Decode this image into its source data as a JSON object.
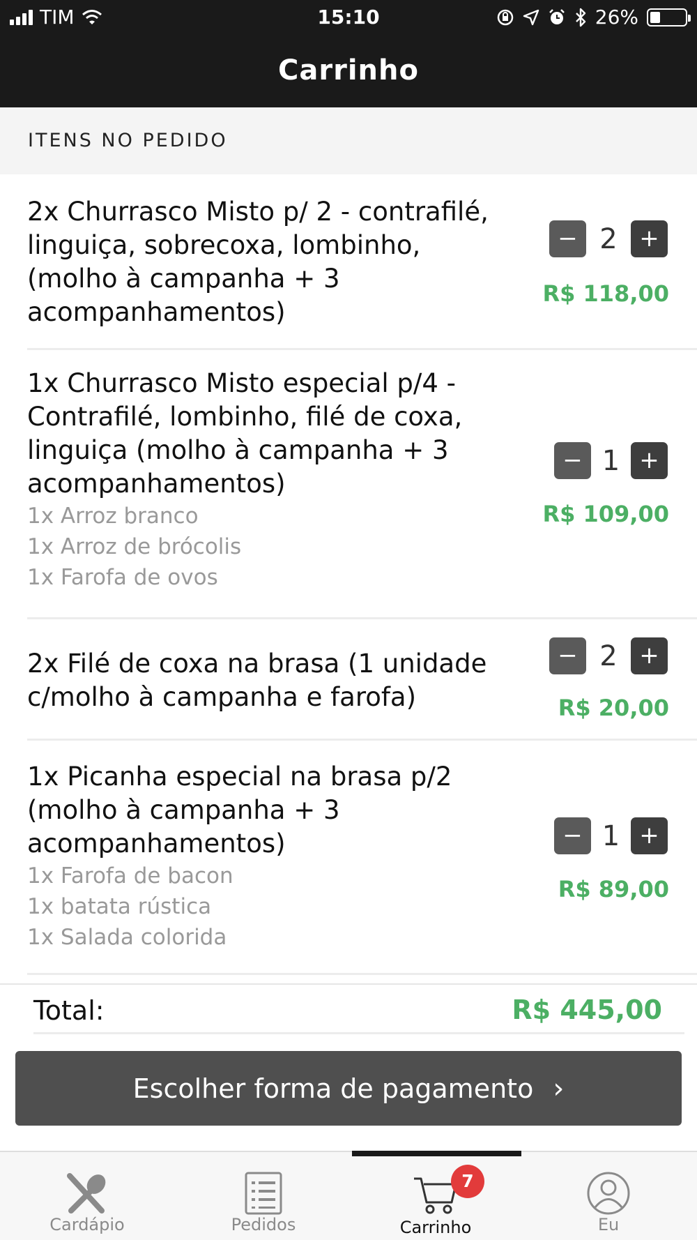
{
  "status_bar": {
    "carrier": "TIM",
    "time": "15:10",
    "battery": "26%",
    "icons": [
      "signal-icon",
      "wifi-icon",
      "orientation-lock-icon",
      "location-icon",
      "alarm-icon",
      "bluetooth-icon",
      "battery-icon"
    ]
  },
  "header": {
    "title": "Carrinho"
  },
  "section": {
    "title": "ITENS NO PEDIDO"
  },
  "items": [
    {
      "name": "2x Churrasco Misto p/ 2 - contrafilé, linguiça, sobrecoxa, lombinho, (molho à campanha + 3 acompanhamentos)",
      "options": [],
      "quantity": "2",
      "price": "R$ 118,00"
    },
    {
      "name": "1x Churrasco Misto especial p/4 - Contrafilé, lombinho, filé de coxa, linguiça (molho à campanha + 3 acompanhamentos)",
      "options": [
        "1x Arroz branco",
        "1x Arroz de brócolis",
        "1x Farofa de ovos"
      ],
      "quantity": "1",
      "price": "R$ 109,00"
    },
    {
      "name": "2x Filé de coxa na brasa (1 unidade c/molho à campanha e farofa)",
      "options": [],
      "quantity": "2",
      "price": "R$ 20,00"
    },
    {
      "name": "1x Picanha especial na brasa p/2 (molho à campanha + 3 acompanhamentos)",
      "options": [
        "1x Farofa de bacon",
        "1x batata rústica",
        "1x Salada colorida"
      ],
      "quantity": "1",
      "price": "R$ 89,00"
    }
  ],
  "quantity_controls": {
    "minus": "−",
    "plus": "+"
  },
  "total": {
    "label": "Total:",
    "value": "R$ 445,00"
  },
  "payment_button": {
    "label": "Escolher forma de pagamento",
    "chevron": "›"
  },
  "tabs": [
    {
      "label": "Cardápio",
      "icon": "fork-knife-icon",
      "active": false
    },
    {
      "label": "Pedidos",
      "icon": "list-icon",
      "active": false
    },
    {
      "label": "Carrinho",
      "icon": "cart-icon",
      "active": true,
      "badge": "7"
    },
    {
      "label": "Eu",
      "icon": "user-icon",
      "active": false
    }
  ],
  "colors": {
    "header_bg": "#1a1a1a",
    "price_green": "#4caf64",
    "button_gray": "#4f4f4f",
    "badge_red": "#e23b3b"
  }
}
